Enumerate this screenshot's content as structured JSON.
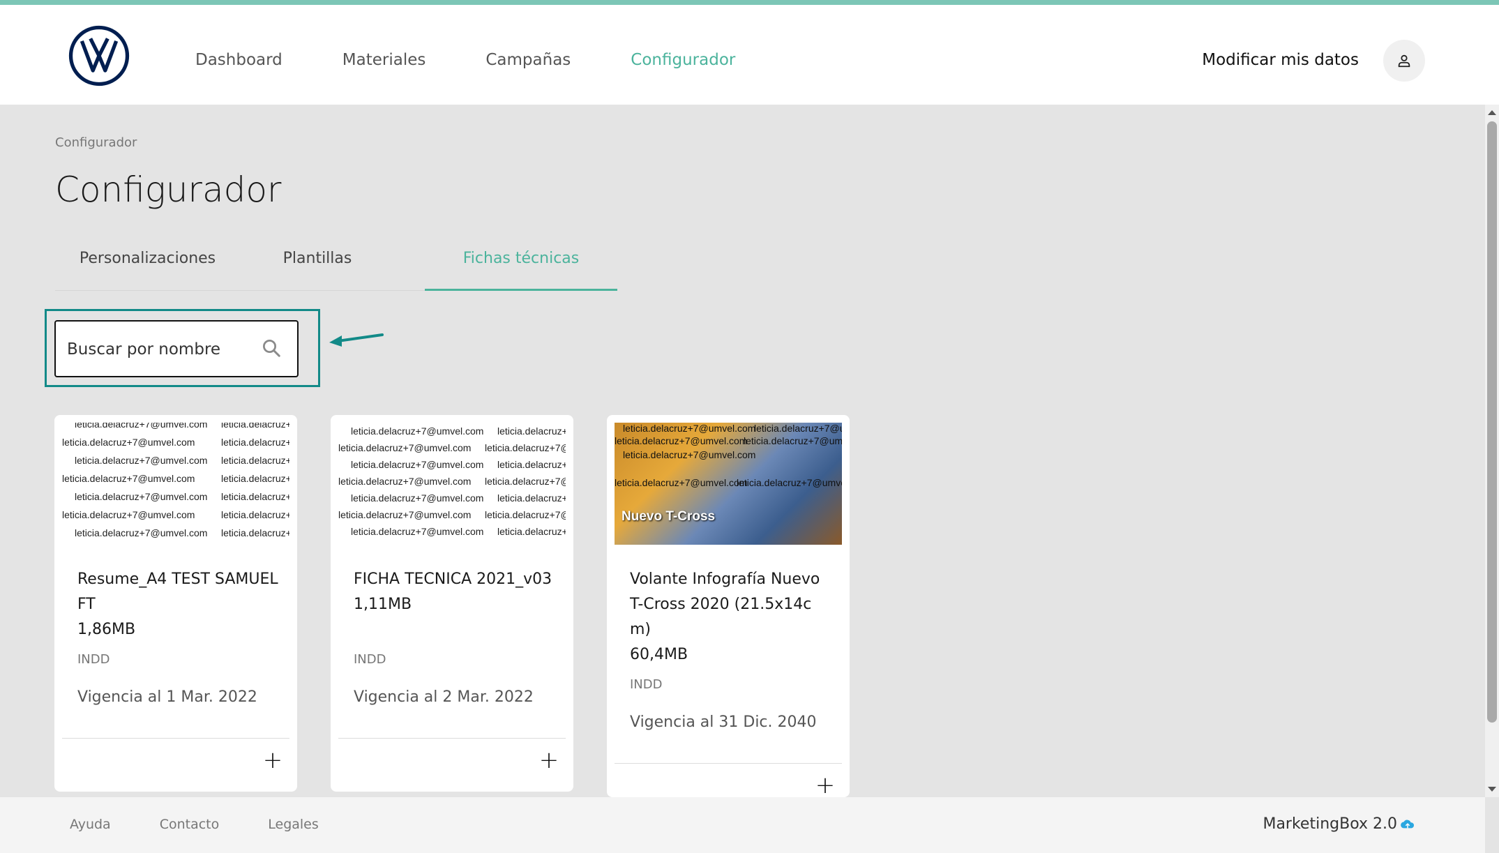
{
  "header": {
    "nav": [
      "Dashboard",
      "Materiales",
      "Campañas",
      "Configurador"
    ],
    "active_nav": "Configurador",
    "modify_label": "Modificar mis datos"
  },
  "breadcrumb": "Configurador",
  "page_title": "Configurador",
  "tabs": [
    "Personalizaciones",
    "Plantillas",
    "Fichas técnicas"
  ],
  "active_tab": "Fichas técnicas",
  "search": {
    "placeholder": "Buscar por nombre"
  },
  "cards": [
    {
      "name": "Resume_A4 TEST SAMUEL FT",
      "size": "1,86MB",
      "type": "INDD",
      "validity": "Vigencia al 1 Mar. 2022",
      "thumb_text": "leticia.delacruz+7@umvel.com"
    },
    {
      "name": "FICHA TECNICA 2021_v03",
      "size": "1,11MB",
      "type": "INDD",
      "validity": "Vigencia al 2 Mar. 2022",
      "thumb_text": "leticia.delacruz+7@umvel.com"
    },
    {
      "name": "Volante Infografía Nuevo T-Cross 2020 (21.5x14cm)",
      "size": "60,4MB",
      "type": "INDD",
      "validity": "Vigencia al 31 Dic. 2040",
      "thumb_text": "leticia.delacruz+7@umvel.com",
      "thumb_title": "Nuevo T-Cross"
    }
  ],
  "footer": {
    "links": [
      "Ayuda",
      "Contacto",
      "Legales"
    ],
    "brand": "MarketingBox 2.0"
  },
  "colors": {
    "accent": "#4bb39c",
    "highlight": "#128a88",
    "top_strip": "#7cc6b6",
    "background": "#e4e4e4"
  }
}
